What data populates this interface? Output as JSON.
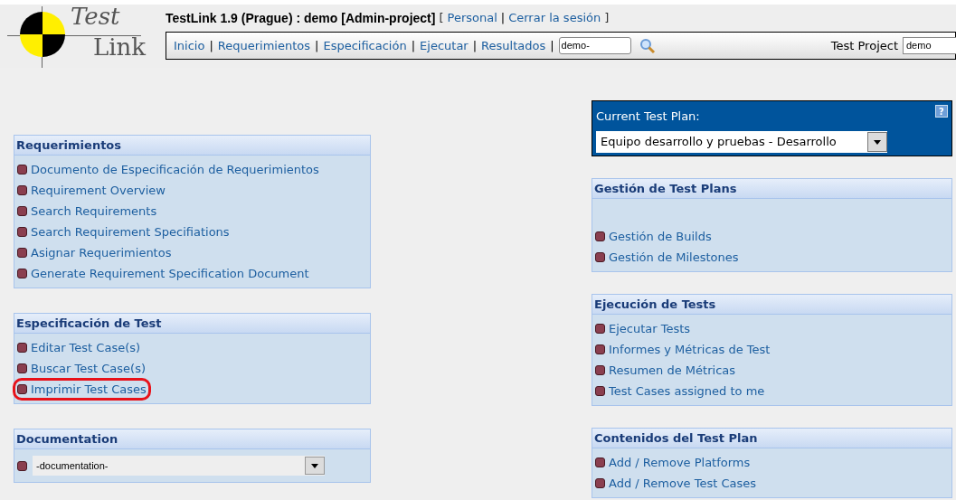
{
  "header": {
    "logo": {
      "line1": "Test",
      "line2": "Link"
    },
    "title": "TestLink 1.9 (Prague) : demo [Admin-project]",
    "user_links": [
      "Personal",
      "Cerrar la sesión"
    ],
    "open_bracket": "[",
    "close_bracket": "]"
  },
  "nav": {
    "links": [
      "Inicio",
      "Requerimientos",
      "Especificación",
      "Ejecutar",
      "Resultados"
    ],
    "separator": "|",
    "search": {
      "value": "demo-"
    },
    "project_label": "Test Project",
    "project_value": "demo"
  },
  "left_panels": [
    {
      "title": "Requerimientos",
      "kind": "links",
      "items": [
        {
          "label": "Documento de Especificación de Requerimientos",
          "highlighted": false
        },
        {
          "label": "Requirement Overview",
          "highlighted": false
        },
        {
          "label": "Search Requirements",
          "highlighted": false
        },
        {
          "label": "Search Requirement Specifiations",
          "highlighted": false
        },
        {
          "label": "Asignar Requerimientos",
          "highlighted": false
        },
        {
          "label": "Generate Requirement Specification Document",
          "highlighted": false
        }
      ]
    },
    {
      "title": "Especificación de Test",
      "kind": "links",
      "items": [
        {
          "label": "Editar Test Case(s)",
          "highlighted": false
        },
        {
          "label": "Buscar Test Case(s)",
          "highlighted": false
        },
        {
          "label": "Imprimir Test Cases",
          "highlighted": true
        }
      ]
    },
    {
      "title": "Documentation",
      "kind": "select",
      "value": "-documentation-"
    }
  ],
  "current_plan": {
    "label": "Current Test Plan:",
    "value": "Equipo desarrollo y pruebas - Desarrollo",
    "help": "?"
  },
  "right_panels": [
    {
      "title": "Gestión de Test Plans",
      "kind": "links",
      "spacer": true,
      "items": [
        {
          "label": "Gestión de Builds",
          "highlighted": false
        },
        {
          "label": "Gestión de Milestones",
          "highlighted": false
        }
      ]
    },
    {
      "title": "Ejecución de Tests",
      "kind": "links",
      "spacer": false,
      "items": [
        {
          "label": "Ejecutar Tests",
          "highlighted": false
        },
        {
          "label": "Informes y Métricas de Test",
          "highlighted": false
        },
        {
          "label": "Resumen de Métricas",
          "highlighted": false
        },
        {
          "label": "Test Cases assigned to me",
          "highlighted": false
        }
      ]
    },
    {
      "title": "Contenidos del Test Plan",
      "kind": "links",
      "spacer": false,
      "items": [
        {
          "label": "Add / Remove Platforms",
          "highlighted": false
        },
        {
          "label": "Add / Remove Test Cases",
          "highlighted": false
        }
      ]
    }
  ]
}
